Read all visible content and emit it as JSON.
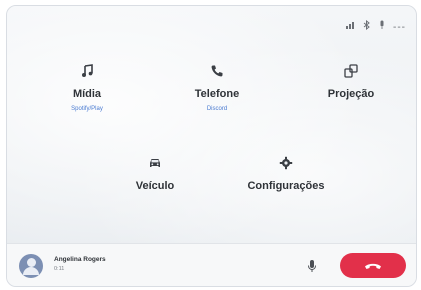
{
  "tiles": {
    "midia": {
      "icon": "music-note-icon",
      "label": "Mídia",
      "sub": "Spotify/Play"
    },
    "telefone": {
      "icon": "phone-icon",
      "label": "Telefone",
      "sub": "Discord"
    },
    "projecao": {
      "icon": "projection-icon",
      "label": "Projeção"
    },
    "veiculo": {
      "icon": "car-icon",
      "label": "Veículo"
    },
    "configuracoes": {
      "icon": "gear-icon",
      "label": "Configurações"
    }
  },
  "call": {
    "caller_name": "Angelina Rogers",
    "duration": "0:11",
    "end_call_icon": "end-call-icon",
    "mic_icon": "microphone-icon"
  },
  "status": {
    "dash": "---"
  },
  "colors": {
    "end_call": "#e2304a",
    "sub_link": "#4a7bd1"
  }
}
